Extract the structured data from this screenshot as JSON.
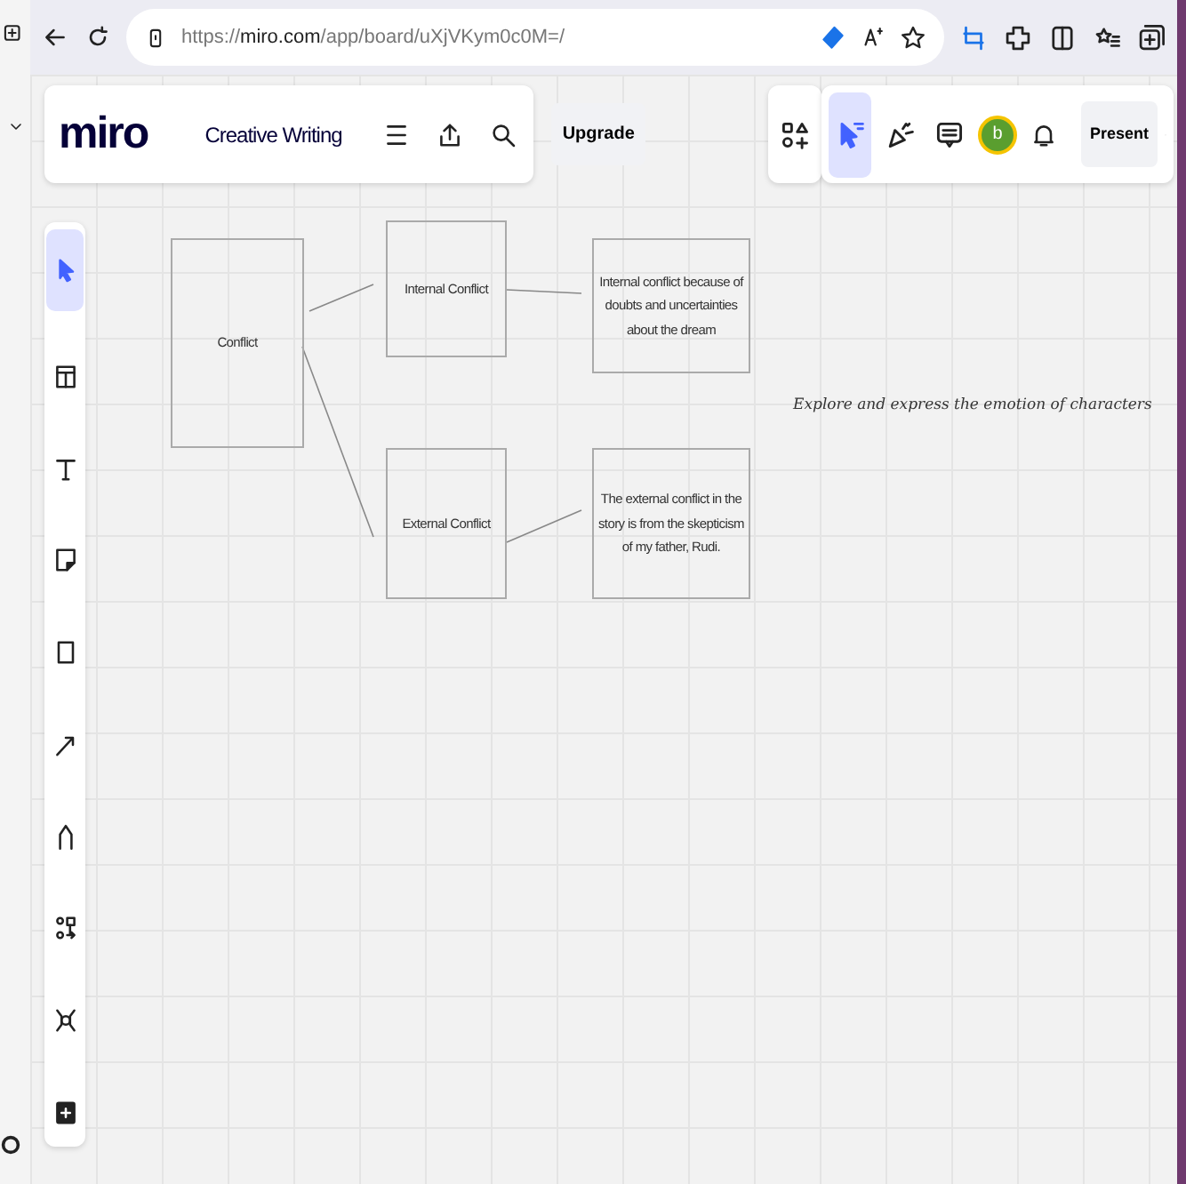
{
  "browser": {
    "url": "https://**miro.com**/app/board/uXjVKym0c0M=/"
  },
  "board": {
    "logo": "miro",
    "title": "Creative Writing",
    "upgrade": "Upgrade",
    "avatar": "b",
    "present": "Present"
  },
  "right_tools": [
    {
      "kind": "apps",
      "selected": false
    },
    {
      "kind": "cursor",
      "selected": true
    },
    {
      "kind": "celebrate",
      "selected": false
    },
    {
      "kind": "comment",
      "selected": false
    }
  ],
  "tools": [
    {
      "kind": "select",
      "selected": true
    },
    {
      "kind": "template",
      "selected": false
    },
    {
      "kind": "text",
      "selected": false
    },
    {
      "kind": "sticky",
      "selected": false
    },
    {
      "kind": "shape",
      "selected": false
    },
    {
      "kind": "arrow",
      "selected": false
    },
    {
      "kind": "pen",
      "selected": false
    },
    {
      "kind": "diagram",
      "selected": false
    },
    {
      "kind": "mindmap",
      "selected": false
    },
    {
      "kind": "more",
      "selected": false
    }
  ],
  "nodes": [
    {
      "text": "Conflict"
    },
    {
      "text": "Internal Conflict"
    },
    {
      "text": "Internal conflict because of doubts and uncertainties about the dream"
    },
    {
      "text": "External Conflict"
    },
    {
      "text": "The external conflict in the story is from the skepticism of my father, Rudi."
    }
  ],
  "note": "Explore and express the emotion of characters"
}
